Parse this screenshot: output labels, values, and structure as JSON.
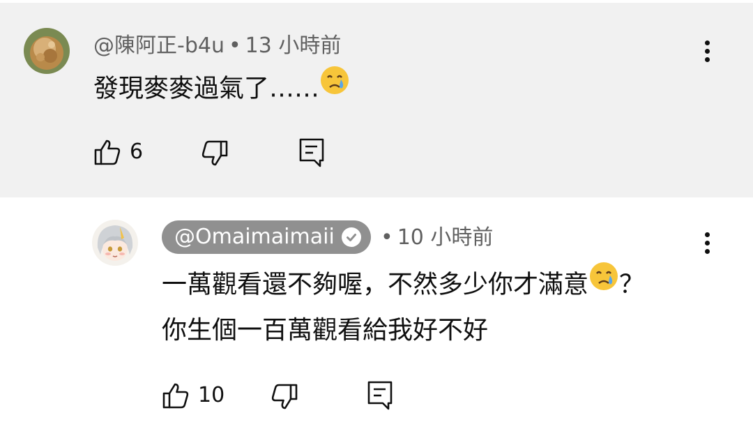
{
  "comment": {
    "handle": "@陳阿正-b4u",
    "separator": "•",
    "time": "13 小時前",
    "text": "發現麥麥過氣了……",
    "emoji": "crying-face-emoji",
    "likes": "6"
  },
  "reply": {
    "handle": "@Omaimaimaii",
    "verified_icon": "verified-check-icon",
    "separator": "•",
    "time": "10 小時前",
    "line1_before_emoji": "一萬觀看還不夠喔，不然多少你才滿意",
    "line1_after_emoji": "？",
    "line2": "你生個一百萬觀看給我好不好",
    "emoji": "crying-face-emoji",
    "likes": "10"
  },
  "colors": {
    "highlight_bg": "#f1f1f1",
    "meta_text": "#606060",
    "pill_bg": "#909090"
  }
}
